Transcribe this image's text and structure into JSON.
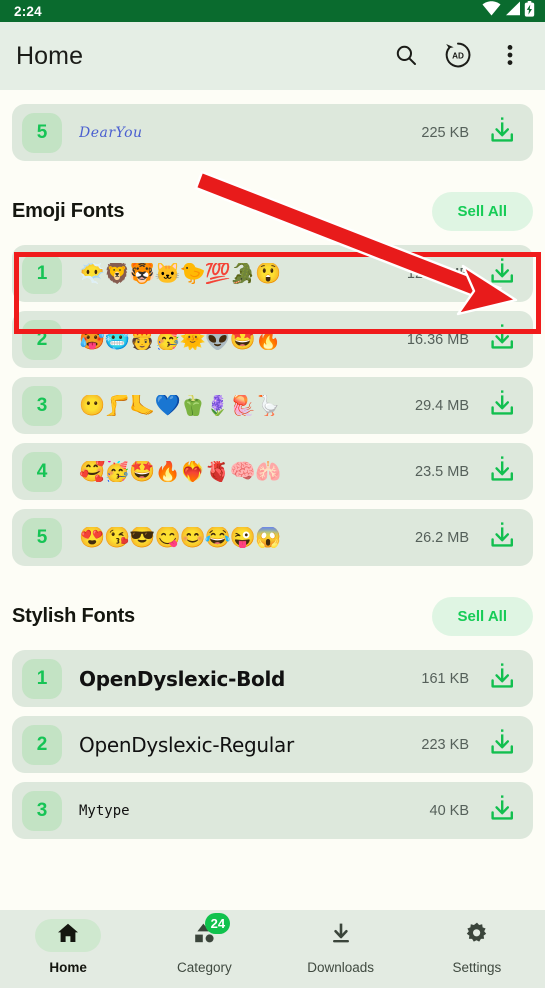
{
  "status_bar": {
    "time": "2:24",
    "icons": [
      "wifi-icon",
      "cellular-signal-icon",
      "battery-charging-icon"
    ]
  },
  "app_bar": {
    "title": "Home",
    "actions": [
      {
        "name": "search-icon",
        "label": "Search"
      },
      {
        "name": "remove-ads-icon",
        "label": "AD"
      },
      {
        "name": "overflow-menu-icon",
        "label": "More options"
      }
    ]
  },
  "colors": {
    "status_bar_bg": "#0a6b2e",
    "app_bar_bg": "#e5eee5",
    "page_bg": "#fdfdf6",
    "row_bg": "#dde8dc",
    "badge_bg": "#c3e3c4",
    "accent_green": "#16c455",
    "annotation_red": "#f01b1b",
    "nav_bg": "#e3ebe2"
  },
  "partial_top_row": {
    "rank": "5",
    "name": "DearYou",
    "size": "225 KB",
    "download_icon": "download-icon"
  },
  "sections": [
    {
      "title": "Emoji Fonts",
      "sell_all_label": "Sell All",
      "rows": [
        {
          "rank": "1",
          "name": "😶‍🌫️🦁🐯🐱🐤💯🐊😲",
          "size": "12.92 MB",
          "download_icon": "download-icon",
          "highlighted": true
        },
        {
          "rank": "2",
          "name": "🥵🥶🫅🥳🌞👽🤩🔥",
          "size": "16.36 MB",
          "download_icon": "download-icon",
          "highlighted": false
        },
        {
          "rank": "3",
          "name": "😶🦵🦶💙🫑🪻🪼🪿",
          "size": "29.4 MB",
          "download_icon": "download-icon",
          "highlighted": false
        },
        {
          "rank": "4",
          "name": "🥰🥳🤩🔥❤️‍🔥🫀🧠🫁",
          "size": "23.5 MB",
          "download_icon": "download-icon",
          "highlighted": false
        },
        {
          "rank": "5",
          "name": "😍😘😎😋😊😂😜😱",
          "size": "26.2 MB",
          "download_icon": "download-icon",
          "highlighted": false
        }
      ]
    },
    {
      "title": "Stylish Fonts",
      "sell_all_label": "Sell All",
      "rows": [
        {
          "rank": "1",
          "name": "OpenDyslexic-Bold",
          "size": "161 KB",
          "download_icon": "download-icon",
          "highlighted": false
        },
        {
          "rank": "2",
          "name": "OpenDyslexic-Regular",
          "size": "223 KB",
          "download_icon": "download-icon",
          "highlighted": false
        },
        {
          "rank": "3",
          "name": "Mytype",
          "size": "40 KB",
          "download_icon": "download-icon",
          "highlighted": false
        }
      ]
    }
  ],
  "bottom_nav": {
    "items": [
      {
        "label": "Home",
        "icon": "home-icon",
        "active": true,
        "badge": null
      },
      {
        "label": "Category",
        "icon": "category-shapes-icon",
        "active": false,
        "badge": "24"
      },
      {
        "label": "Downloads",
        "icon": "download-icon",
        "active": false,
        "badge": null
      },
      {
        "label": "Settings",
        "icon": "gear-icon",
        "active": false,
        "badge": null
      }
    ]
  },
  "annotation": {
    "type": "red-arrow-and-box",
    "target": "download-button-of-first-emoji-font-row"
  }
}
